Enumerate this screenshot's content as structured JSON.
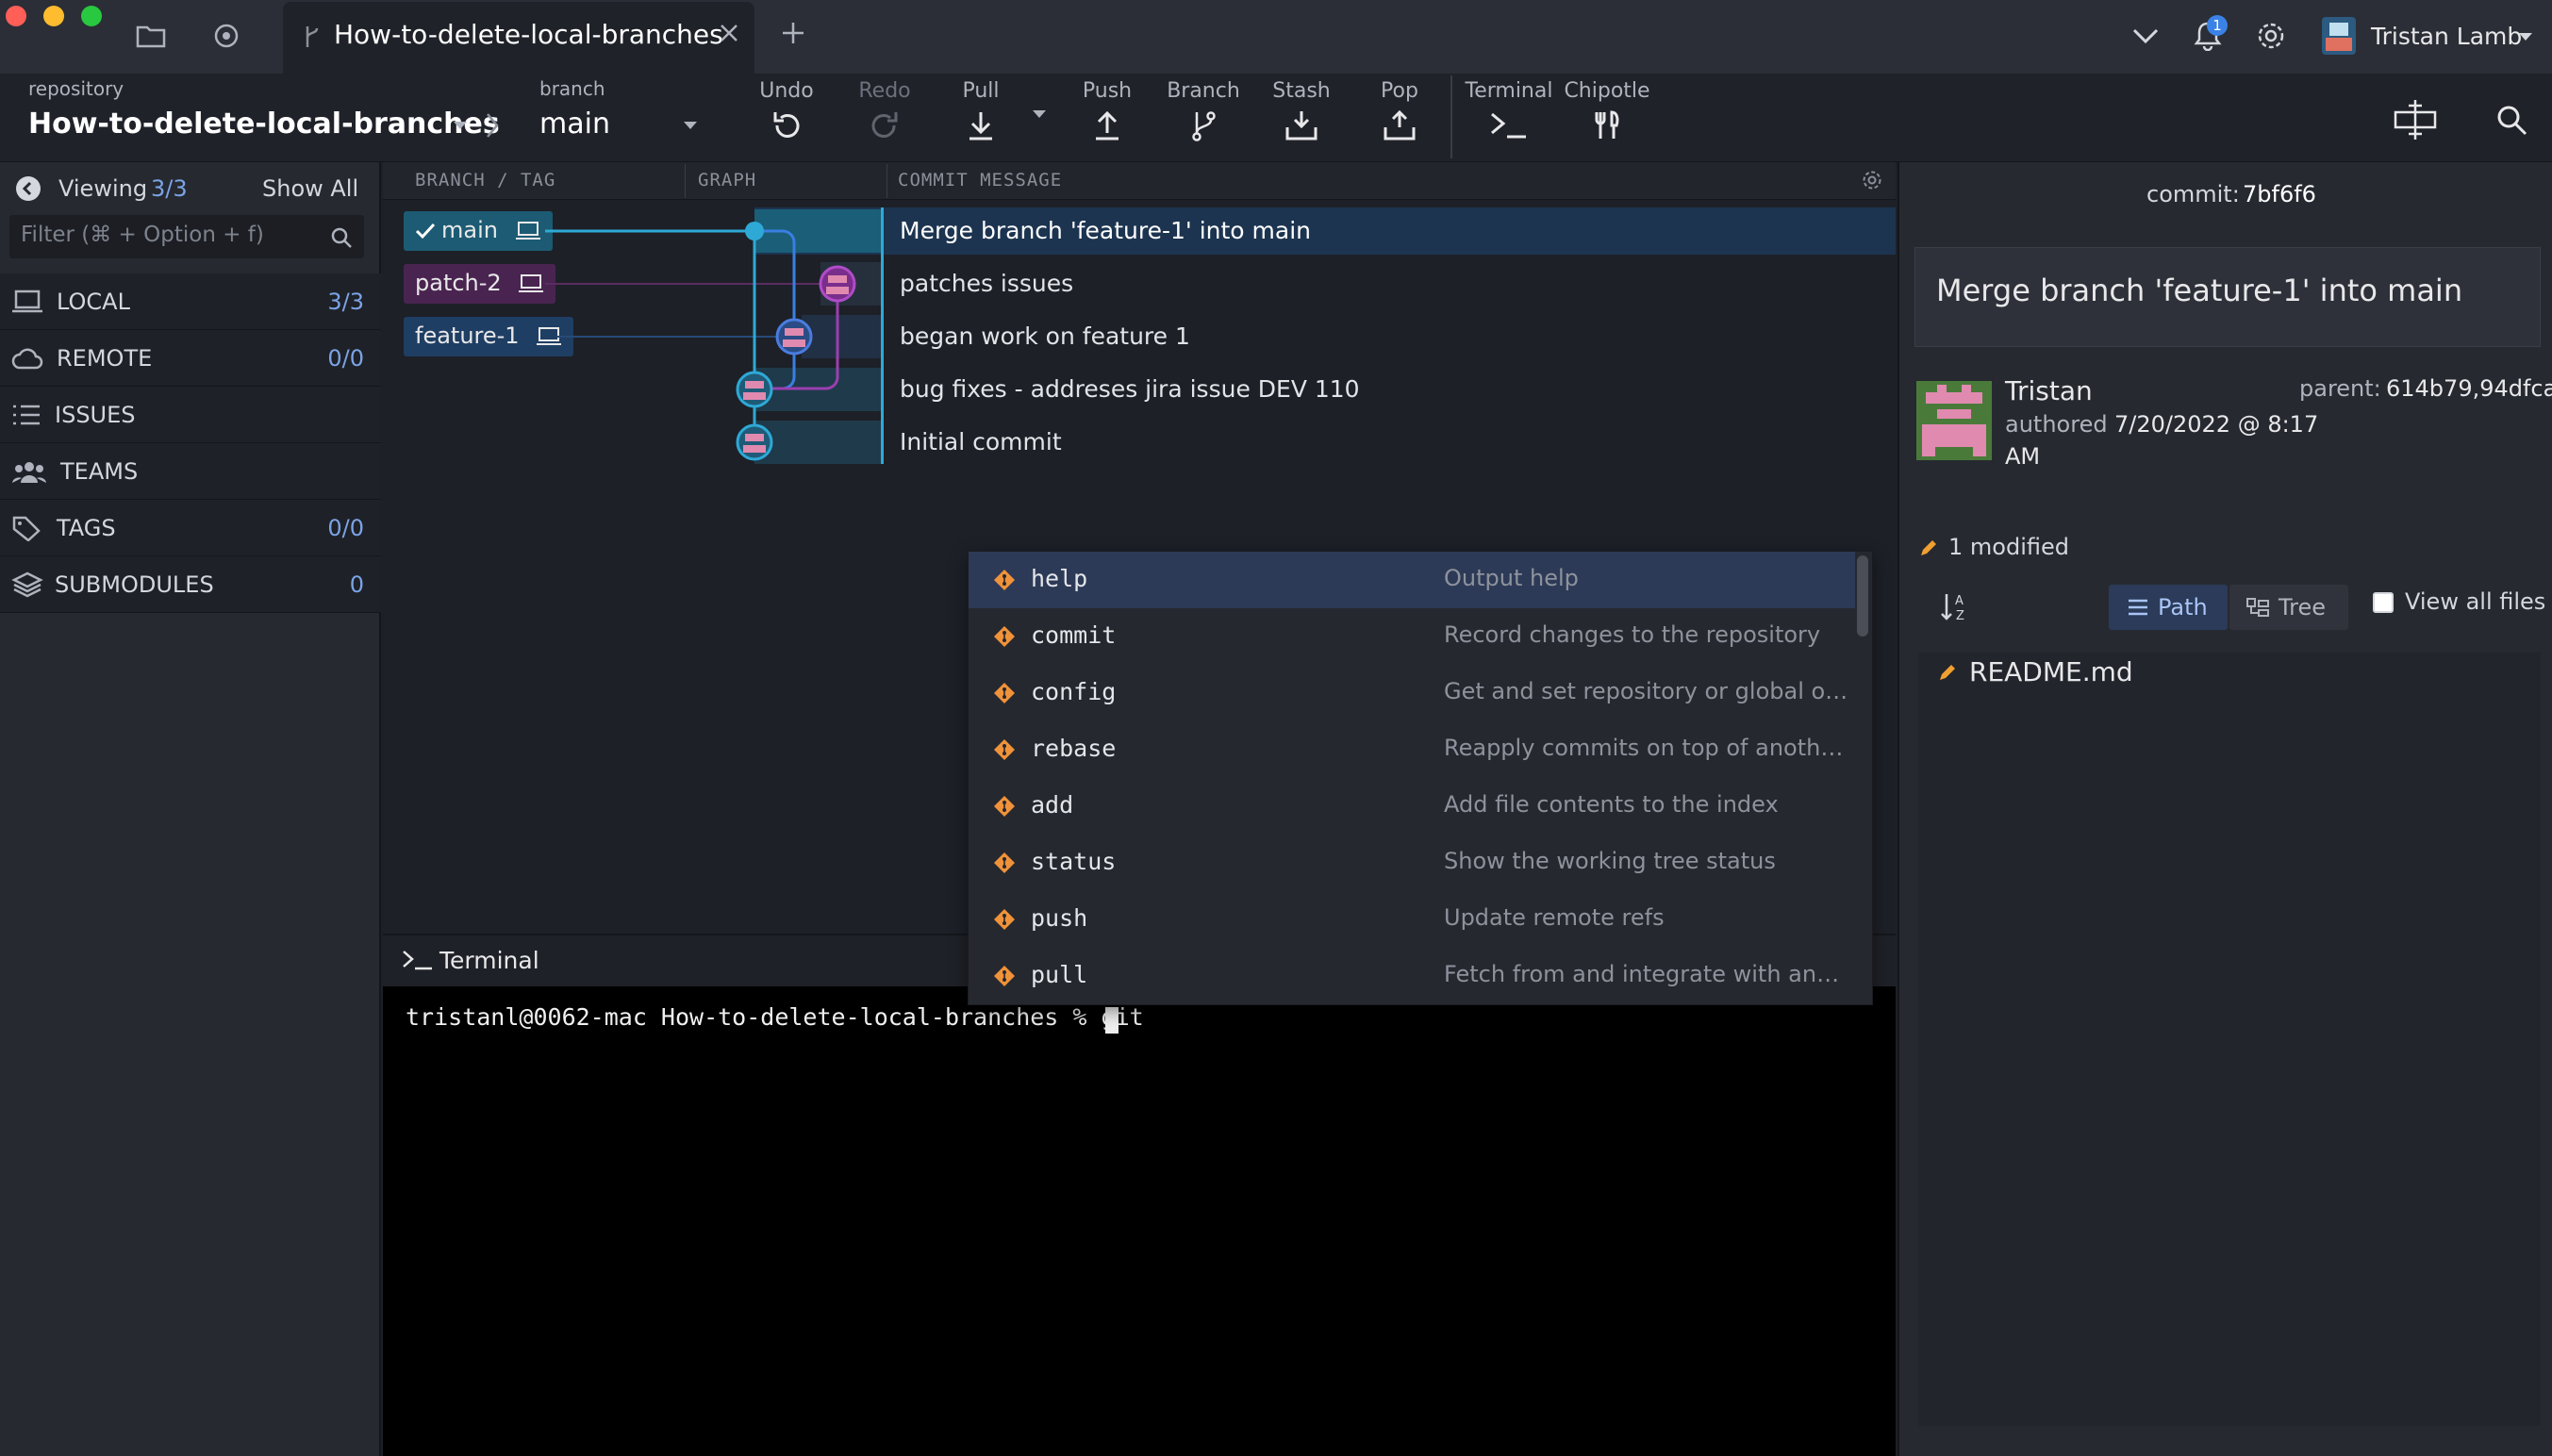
{
  "titlebar": {
    "tab_title": "How-to-delete-local-branches",
    "notification_count": "1",
    "user_name": "Tristan Lamb"
  },
  "toolbar": {
    "repo_caption": "repository",
    "repo_name": "How-to-delete-local-branches",
    "branch_caption": "branch",
    "branch_name": "main",
    "undo": "Undo",
    "redo": "Redo",
    "pull": "Pull",
    "push": "Push",
    "branch": "Branch",
    "stash": "Stash",
    "pop": "Pop",
    "terminal": "Terminal",
    "chipotle": "Chipotle"
  },
  "sidebar": {
    "viewing_label": "Viewing",
    "viewing_count": "3/3",
    "show_all": "Show All",
    "filter_placeholder": "Filter (⌘ + Option + f)",
    "sections": [
      {
        "label": "LOCAL",
        "count": "3/3"
      },
      {
        "label": "REMOTE",
        "count": "0/0"
      },
      {
        "label": "ISSUES",
        "count": ""
      },
      {
        "label": "TEAMS",
        "count": ""
      },
      {
        "label": "TAGS",
        "count": "0/0"
      },
      {
        "label": "SUBMODULES",
        "count": "0"
      }
    ]
  },
  "graph": {
    "col_branch": "BRANCH / TAG",
    "col_graph": "GRAPH",
    "col_message": "COMMIT MESSAGE",
    "branches": [
      "main",
      "patch-2",
      "feature-1"
    ],
    "commits": [
      "Merge branch 'feature-1' into main",
      "patches issues",
      "began work on feature 1",
      "bug fixes - addreses jira issue DEV 110",
      "Initial commit"
    ]
  },
  "terminal": {
    "title": "Terminal",
    "prompt": "tristanl@0062-mac How-to-delete-local-branches % git "
  },
  "autocomplete": [
    {
      "cmd": "help",
      "desc": "Output help"
    },
    {
      "cmd": "commit",
      "desc": "Record changes to the repository"
    },
    {
      "cmd": "config",
      "desc": "Get and set repository or global op..."
    },
    {
      "cmd": "rebase",
      "desc": "Reapply commits on top of anothe..."
    },
    {
      "cmd": "add",
      "desc": "Add file contents to the index"
    },
    {
      "cmd": "status",
      "desc": "Show the working tree status"
    },
    {
      "cmd": "push",
      "desc": "Update remote refs"
    },
    {
      "cmd": "pull",
      "desc": "Fetch from and integrate with anot..."
    }
  ],
  "detail": {
    "commit_label": "commit:",
    "commit_sha": "7bf6f6",
    "message": "Merge branch 'feature-1' into main",
    "author": "Tristan",
    "parent_label": "parent:",
    "parent_shas": "614b79,94dfca",
    "authored_label": "authored",
    "authored_date": "7/20/2022 @ 8:17",
    "authored_time_suffix": "AM",
    "modified": "1 modified",
    "path_tab": "Path",
    "tree_tab": "Tree",
    "view_all": "View all files",
    "files": [
      "README.md"
    ]
  },
  "colors": {
    "main_branch": "#1c5b73",
    "patch_branch": "#4a2450",
    "feature_branch": "#1f3e63",
    "accent": "#2ea9d6"
  }
}
